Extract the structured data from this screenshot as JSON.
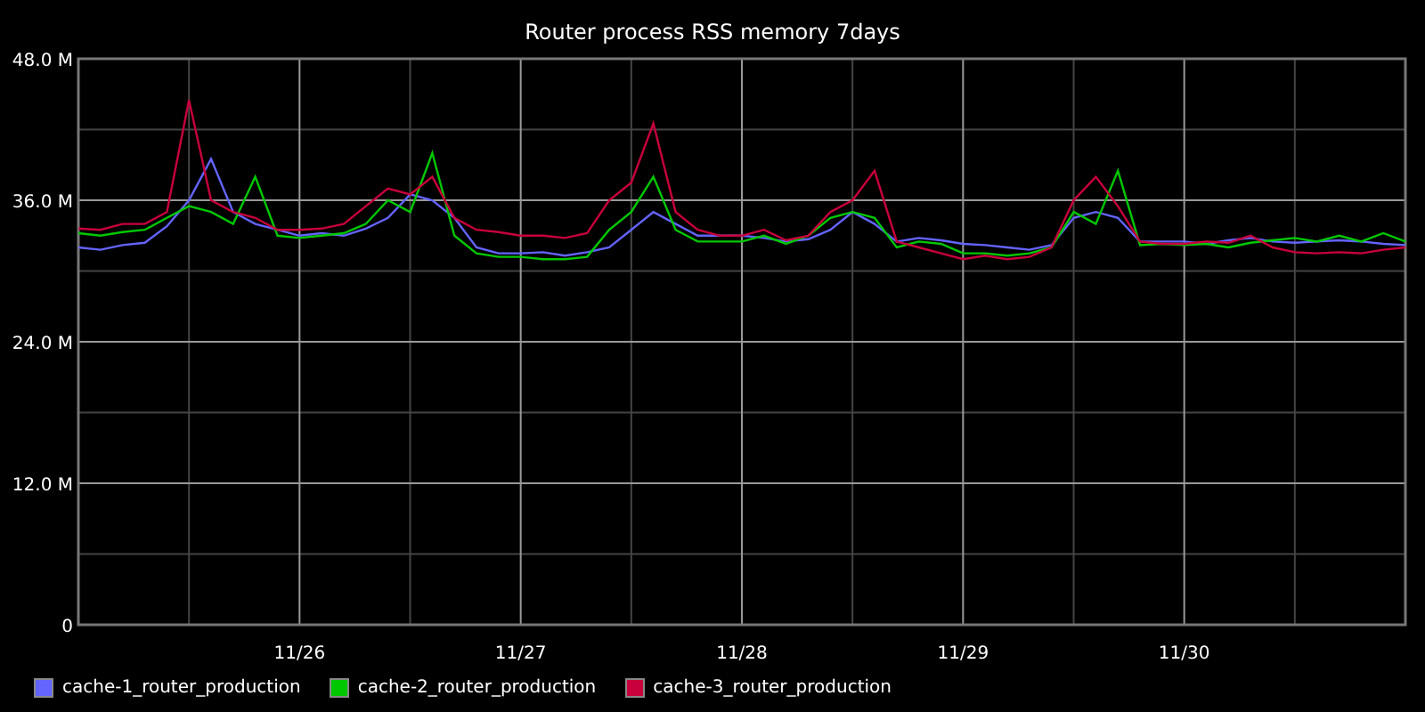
{
  "chart_data": {
    "type": "line",
    "title": "Router process RSS memory 7days",
    "categories": [
      null,
      null,
      null,
      null,
      null,
      null,
      null,
      null,
      null,
      null,
      "11/26",
      null,
      null,
      null,
      null,
      null,
      null,
      null,
      null,
      null,
      "11/27",
      null,
      null,
      null,
      null,
      null,
      null,
      null,
      null,
      null,
      "11/28",
      null,
      null,
      null,
      null,
      null,
      null,
      null,
      null,
      null,
      "11/29",
      null,
      null,
      null,
      null,
      null,
      null,
      null,
      null,
      null,
      "11/30",
      null,
      null,
      null,
      null,
      null,
      null,
      null,
      null,
      null,
      null
    ],
    "series": [
      {
        "name": "cache-1_router_production",
        "color": "#6464ff",
        "values": [
          32.0,
          31.8,
          32.2,
          32.4,
          33.8,
          36.0,
          39.5,
          35.0,
          34.0,
          33.5,
          33.0,
          33.2,
          33.0,
          33.6,
          34.5,
          36.5,
          36.0,
          34.5,
          32.0,
          31.5,
          31.5,
          31.6,
          31.3,
          31.6,
          32.0,
          33.5,
          35.0,
          34.0,
          33.0,
          33.0,
          33.0,
          32.8,
          32.5,
          32.7,
          33.5,
          35.0,
          34.0,
          32.5,
          32.8,
          32.6,
          32.3,
          32.2,
          32.0,
          31.8,
          32.2,
          34.5,
          35.0,
          34.5,
          32.5,
          32.5,
          32.5,
          32.3,
          32.6,
          32.8,
          32.5,
          32.4,
          32.5,
          32.6,
          32.5,
          32.3,
          32.2
        ]
      },
      {
        "name": "cache-2_router_production",
        "color": "#00c800",
        "values": [
          33.2,
          33.0,
          33.3,
          33.5,
          34.5,
          35.5,
          35.0,
          34.0,
          38.0,
          33.0,
          32.8,
          33.0,
          33.2,
          34.0,
          36.0,
          35.0,
          40.0,
          33.0,
          31.5,
          31.2,
          31.2,
          31.0,
          31.0,
          31.2,
          33.5,
          35.0,
          38.0,
          33.5,
          32.5,
          32.5,
          32.5,
          33.0,
          32.3,
          33.0,
          34.5,
          35.0,
          34.5,
          32.0,
          32.5,
          32.3,
          31.5,
          31.5,
          31.3,
          31.5,
          32.0,
          35.0,
          34.0,
          38.5,
          32.2,
          32.3,
          32.2,
          32.3,
          32.0,
          32.4,
          32.6,
          32.8,
          32.5,
          33.0,
          32.5,
          33.2,
          32.5
        ]
      },
      {
        "name": "cache-3_router_production",
        "color": "#c8003c",
        "values": [
          33.6,
          33.5,
          34.0,
          34.0,
          35.0,
          44.5,
          36.0,
          35.0,
          34.5,
          33.5,
          33.5,
          33.6,
          34.0,
          35.5,
          37.0,
          36.5,
          38.0,
          34.5,
          33.5,
          33.3,
          33.0,
          33.0,
          32.8,
          33.2,
          36.0,
          37.5,
          42.5,
          35.0,
          33.5,
          33.0,
          33.0,
          33.5,
          32.6,
          33.0,
          35.0,
          36.0,
          38.5,
          32.5,
          32.0,
          31.5,
          31.0,
          31.3,
          31.0,
          31.2,
          32.0,
          36.0,
          38.0,
          35.5,
          32.5,
          32.3,
          32.3,
          32.5,
          32.4,
          33.0,
          32.0,
          31.6,
          31.5,
          31.6,
          31.5,
          31.8,
          32.0
        ]
      }
    ],
    "ylim": [
      0,
      48
    ],
    "grid": true,
    "yticks": [
      {
        "value": 0,
        "label": "0"
      },
      {
        "value": 12,
        "label": "12.0 M"
      },
      {
        "value": 24,
        "label": "24.0 M"
      },
      {
        "value": 36,
        "label": "36.0 M"
      },
      {
        "value": 48,
        "label": "48.0 M"
      }
    ]
  }
}
